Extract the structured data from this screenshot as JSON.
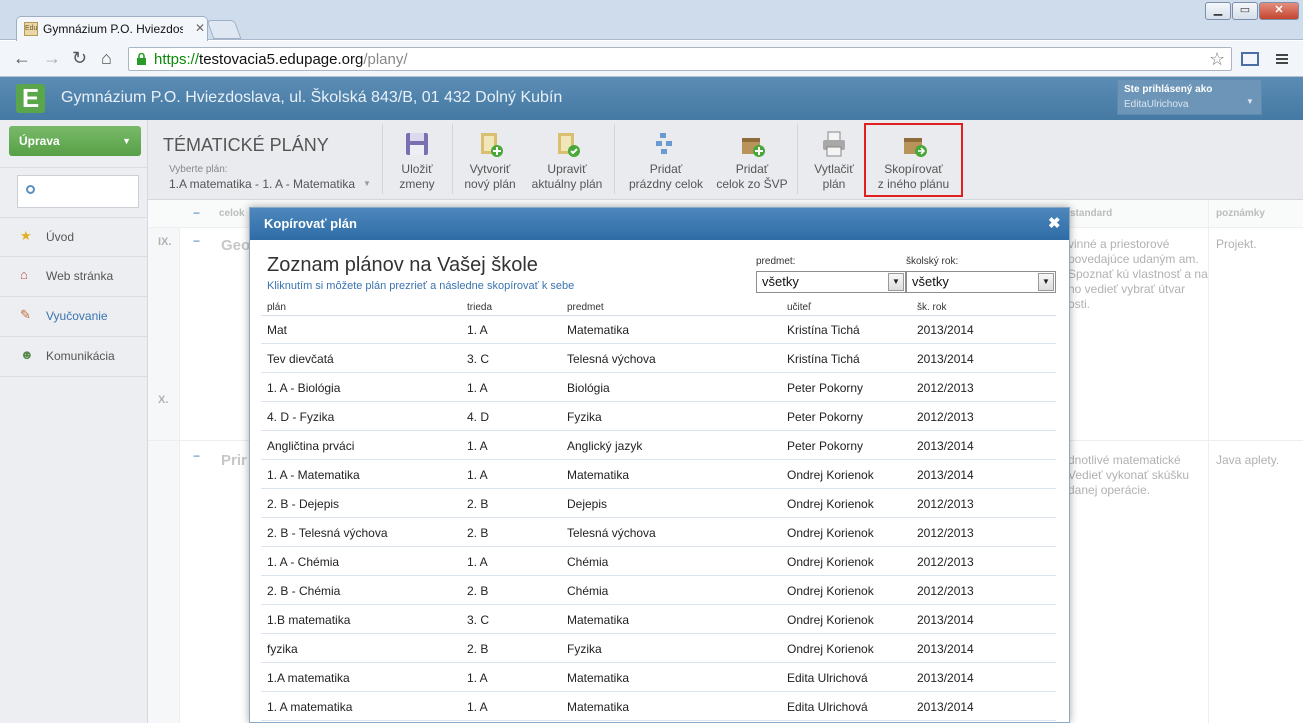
{
  "browser": {
    "tab_title": "Gymnázium P.O. Hviezdos",
    "tab_favicon_text": "Edu",
    "url_scheme": "https://",
    "url_host": "testovacia5.edupage.org",
    "url_path": "/plany/"
  },
  "site": {
    "logo_letter": "E",
    "school_name": "Gymnázium P.O. Hviezdoslava, ul. Školská 843/B, 01 432 Dolný Kubín",
    "login_label": "Ste prihlásený ako",
    "login_user": "EditaUlrichova"
  },
  "sidebar": {
    "edit_button": "Úprava",
    "items": [
      {
        "label": "Úvod",
        "icon": "star-icon"
      },
      {
        "label": "Web stránka",
        "icon": "house-icon"
      },
      {
        "label": "Vyučovanie",
        "icon": "pen-icon"
      },
      {
        "label": "Komunikácia",
        "icon": "people-icon"
      }
    ]
  },
  "plans": {
    "title": "TÉMATICKÉ PLÁNY",
    "select_label": "Vyberte plán:",
    "selected_plan": "1.A matematika - 1. A - Matematika"
  },
  "toolbar": {
    "save_1": "Uložiť",
    "save_2": "zmeny",
    "new_1": "Vytvoriť",
    "new_2": "nový plán",
    "update_1": "Upraviť",
    "update_2": "aktuálny plán",
    "add_empty_1": "Pridať",
    "add_empty_2": "prázdny celok",
    "add_svp_1": "Pridať",
    "add_svp_2": "celok zo ŠVP",
    "print_1": "Vytlačiť",
    "print_2": "plán",
    "copy_1": "Skopírovať",
    "copy_2": "z iného plánu"
  },
  "background": {
    "col_celok": "celok",
    "col_standard": "standard",
    "col_poznamky": "poznámky",
    "row1_num": "IX.",
    "row1_unit": "Geo",
    "row1_standard": "vinné a priestorové povedajúce udaným am.  Spoznať kú vlastnosť a na ho vedieť vybrať útvar osti.",
    "row1_note": "Projekt.",
    "row2_num": "X.",
    "row3_unit": "Prir",
    "row3_standard": "dnotlivé matematické Vedieť vykonať skúšku danej operácie.",
    "row3_note": "Java aplety."
  },
  "modal": {
    "header": "Kopírovať plán",
    "title": "Zoznam plánov na Vašej škole",
    "hint": "Kliknutím si môžete plán prezrieť a následne skopírovať k sebe",
    "filter_subject_label": "predmet:",
    "filter_subject_value": "všetky",
    "filter_year_label": "školský rok:",
    "filter_year_value": "všetky",
    "columns": {
      "plan": "plán",
      "class": "trieda",
      "subject": "predmet",
      "teacher": "učiteľ",
      "year": "šk. rok"
    },
    "rows": [
      {
        "plan": "Mat",
        "class": "1. A",
        "subject": "Matematika",
        "teacher": "Kristína Tichá",
        "year": "2013/2014"
      },
      {
        "plan": "Tev dievčatá",
        "class": "3. C",
        "subject": "Telesná výchova",
        "teacher": "Kristína Tichá",
        "year": "2013/2014"
      },
      {
        "plan": "1. A - Biológia",
        "class": "1. A",
        "subject": "Biológia",
        "teacher": "Peter Pokorny",
        "year": "2012/2013"
      },
      {
        "plan": "4. D - Fyzika",
        "class": "4. D",
        "subject": "Fyzika",
        "teacher": "Peter Pokorny",
        "year": "2012/2013"
      },
      {
        "plan": "Angličtina prváci",
        "class": "1. A",
        "subject": "Anglický jazyk",
        "teacher": "Peter Pokorny",
        "year": "2013/2014"
      },
      {
        "plan": "1. A - Matematika",
        "class": "1. A",
        "subject": "Matematika",
        "teacher": "Ondrej Korienok",
        "year": "2013/2014"
      },
      {
        "plan": "2. B - Dejepis",
        "class": "2. B",
        "subject": "Dejepis",
        "teacher": "Ondrej Korienok",
        "year": "2012/2013"
      },
      {
        "plan": "2. B - Telesná výchova",
        "class": "2. B",
        "subject": "Telesná výchova",
        "teacher": "Ondrej Korienok",
        "year": "2012/2013"
      },
      {
        "plan": "1. A - Chémia",
        "class": "1. A",
        "subject": "Chémia",
        "teacher": "Ondrej Korienok",
        "year": "2012/2013"
      },
      {
        "plan": "2. B - Chémia",
        "class": "2. B",
        "subject": "Chémia",
        "teacher": "Ondrej Korienok",
        "year": "2012/2013"
      },
      {
        "plan": "1.B matematika",
        "class": "3. C",
        "subject": "Matematika",
        "teacher": "Ondrej Korienok",
        "year": "2013/2014"
      },
      {
        "plan": "fyzika",
        "class": "2. B",
        "subject": "Fyzika",
        "teacher": "Ondrej Korienok",
        "year": "2013/2014"
      },
      {
        "plan": "1.A matematika",
        "class": "1. A",
        "subject": "Matematika",
        "teacher": "Edita Ulrichová",
        "year": "2013/2014"
      },
      {
        "plan": "1. A matematika",
        "class": "1. A",
        "subject": "Matematika",
        "teacher": "Edita Ulrichová",
        "year": "2013/2014"
      }
    ]
  }
}
